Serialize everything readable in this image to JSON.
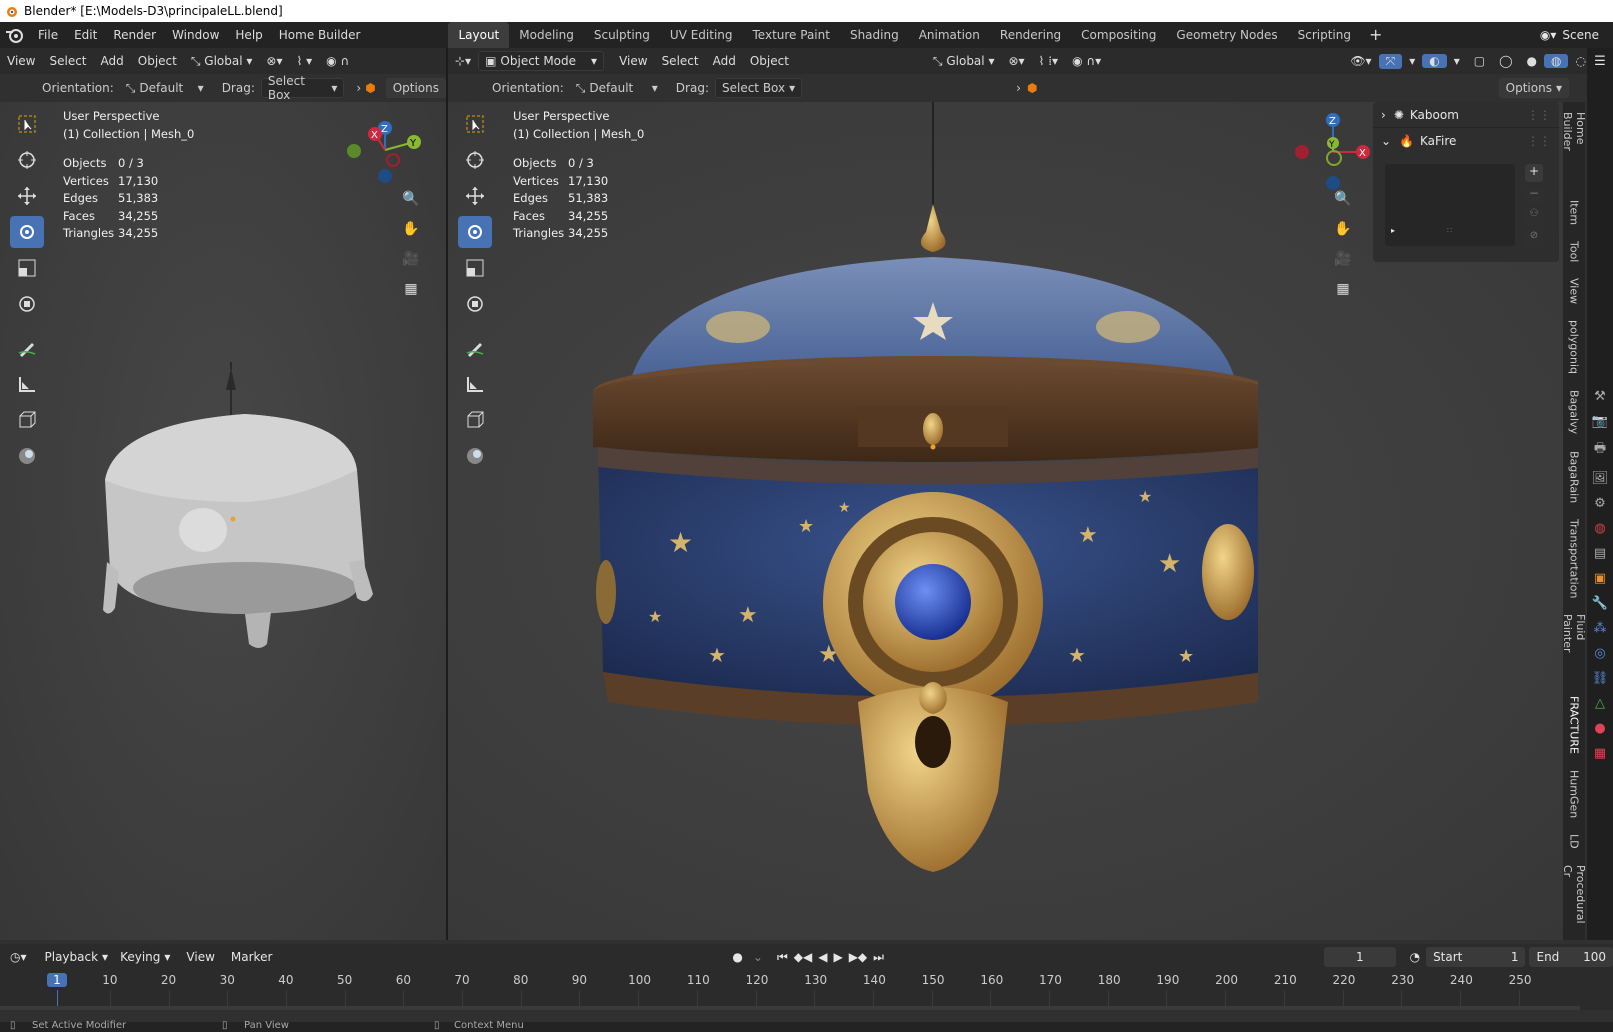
{
  "window_title": "Blender* [E:\\Models-D3\\principaleLL.blend]",
  "menu": [
    "File",
    "Edit",
    "Render",
    "Window",
    "Help",
    "Home Builder"
  ],
  "workspaces": [
    "Layout",
    "Modeling",
    "Sculpting",
    "UV Editing",
    "Texture Paint",
    "Shading",
    "Animation",
    "Rendering",
    "Compositing",
    "Geometry Nodes",
    "Scripting"
  ],
  "active_workspace": "Layout",
  "scene": "Scene",
  "left_view": {
    "menu": [
      "View",
      "Select",
      "Add",
      "Object"
    ],
    "transform": "Global",
    "orientation_label": "Orientation:",
    "orientation": "Default",
    "drag_label": "Drag:",
    "drag": "Select Box",
    "options": "Options",
    "perspective": "User Perspective",
    "collection": "(1) Collection | Mesh_0"
  },
  "right_view": {
    "mode": "Object Mode",
    "menu": [
      "View",
      "Select",
      "Add",
      "Object"
    ],
    "transform": "Global",
    "orientation_label": "Orientation:",
    "orientation": "Default",
    "drag_label": "Drag:",
    "drag": "Select Box",
    "options": "Options",
    "perspective": "User Perspective",
    "collection": "(1) Collection | Mesh_0"
  },
  "stats": [
    {
      "k": "Objects",
      "v": "0 / 3"
    },
    {
      "k": "Vertices",
      "v": "17,130"
    },
    {
      "k": "Edges",
      "v": "51,383"
    },
    {
      "k": "Faces",
      "v": "34,255"
    },
    {
      "k": "Triangles",
      "v": "34,255"
    }
  ],
  "n_panel": {
    "items": [
      "Kaboom",
      "KaFire"
    ]
  },
  "side_tabs": [
    "Home Builder",
    "Item",
    "Tool",
    "View",
    "polygoniq",
    "Bagalvy",
    "BagaRain",
    "Transportation",
    "Fluid Painter",
    "FRACTURE",
    "HumGen",
    "LD",
    "Procedural Cr"
  ],
  "timeline": {
    "menu": [
      "Playback",
      "Keying",
      "View",
      "Marker"
    ],
    "current_frame": "1",
    "start_label": "Start",
    "start": "1",
    "end_label": "End",
    "end": "100",
    "ticks": [
      "1",
      "10",
      "20",
      "30",
      "40",
      "50",
      "60",
      "70",
      "80",
      "90",
      "100",
      "110",
      "120",
      "130",
      "140",
      "150",
      "160",
      "170",
      "180",
      "190",
      "200",
      "210",
      "220",
      "230",
      "240",
      "250"
    ]
  },
  "statusbar": [
    "Set Active Modifier",
    "Pan View",
    "Context Menu"
  ],
  "gizmo": {
    "x": "X",
    "y": "Y",
    "z": "Z"
  }
}
